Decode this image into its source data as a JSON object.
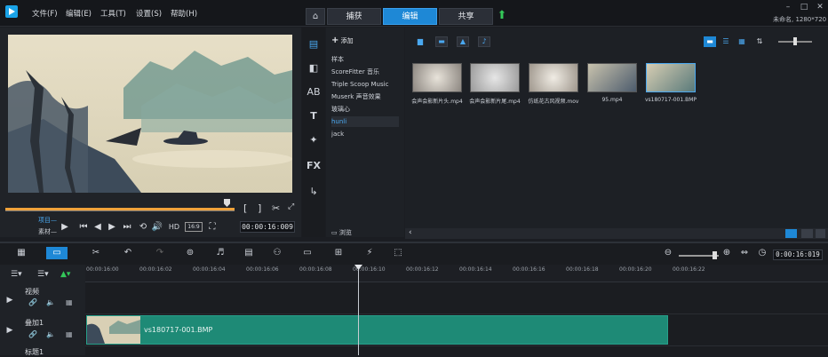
{
  "menu": {
    "file": "文件(F)",
    "edit": "编辑(E)",
    "tools": "工具(T)",
    "settings": "设置(S)",
    "help": "帮助(H)"
  },
  "steps": {
    "capture": "捕获",
    "edit": "编辑",
    "share": "共享"
  },
  "project_info": "未命名, 1280*720",
  "preview": {
    "mode_project": "项目—",
    "mode_clip": "素材—",
    "timecode": "00:00:16:009",
    "hd": "HD",
    "ratio": "16:9"
  },
  "library": {
    "add_label": "添加",
    "folders": [
      "样本",
      "ScoreFitter 音乐",
      "Triple Scoop Music",
      "Muserk 声音效果",
      "玻璃心",
      "hunli",
      "jack"
    ],
    "selected_folder": "hunli",
    "browse_label": "浏览",
    "items": [
      {
        "label": "会声会影新片头.mp4"
      },
      {
        "label": "会声会影新片尾.mp4"
      },
      {
        "label": "仿纸花古风视频.mov"
      },
      {
        "label": "95.mp4"
      },
      {
        "label": "vs180717-001.BMP"
      }
    ]
  },
  "timeline": {
    "timecode": "0:00:16:019",
    "ruler_ticks": [
      "00:00:16:00",
      "00:00:16:02",
      "00:00:16:04",
      "00:00:16:06",
      "00:00:16:08",
      "00:00:16:10",
      "00:00:16:12",
      "00:00:16:14",
      "00:00:16:16",
      "00:00:16:18",
      "00:00:16:20",
      "00:00:16:22"
    ],
    "tracks": [
      {
        "name": "视频"
      },
      {
        "name": "叠加1"
      },
      {
        "name": "标题1"
      }
    ],
    "clip_name": "vs180717-001.BMP"
  },
  "colors": {
    "accent": "#1e88d6",
    "clip": "#1e8a76",
    "scrub": "#f0a23a"
  }
}
